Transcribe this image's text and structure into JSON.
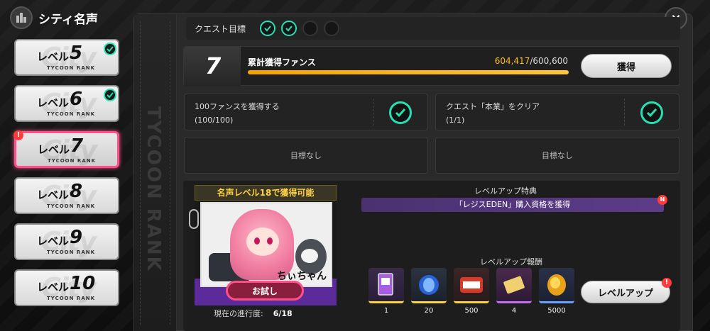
{
  "header": {
    "title": "シティ名声"
  },
  "ranks": [
    {
      "label": "レベル",
      "num": "5",
      "sub": "TYCOON RANK",
      "done": true
    },
    {
      "label": "レベル",
      "num": "6",
      "sub": "TYCOON RANK",
      "done": true
    },
    {
      "label": "レベル",
      "num": "7",
      "sub": "TYCOON RANK",
      "done": false,
      "alert": "!"
    },
    {
      "label": "レベル",
      "num": "8",
      "sub": "TYCOON RANK",
      "done": false
    },
    {
      "label": "レベル",
      "num": "9",
      "sub": "TYCOON RANK",
      "done": false
    },
    {
      "label": "レベル",
      "num": "10",
      "sub": "TYCOON RANK",
      "done": false
    }
  ],
  "side_watermark": "TYCOON RANK",
  "close_icon": "×",
  "quest": {
    "header_label": "クエスト目標",
    "goals_completed": 2,
    "goals_total": 4
  },
  "fans": {
    "level": "7",
    "label": "累計獲得ファンス",
    "current": "604,417",
    "total": "/600,600",
    "progress_pct": 100,
    "acquire_label": "獲得"
  },
  "conditions": [
    {
      "title": "100ファンスを獲得する",
      "progress": "(100/100)",
      "done": true
    },
    {
      "title": "クエスト「本業」をクリア",
      "progress": "(1/1)",
      "done": true
    }
  ],
  "empty_goals": [
    "目標なし",
    "目標なし"
  ],
  "character": {
    "banner": "名声レベル18で獲得可能",
    "name": "ちぃちゃん",
    "trial_label": "お試し",
    "progress_label": "現在の進行度:",
    "progress_value": "6/18"
  },
  "perks": {
    "title": "レベルアップ特典",
    "item": "「レジスEDEN」購入資格を獲得",
    "badge": "N"
  },
  "rewards": {
    "title": "レベルアップ報酬",
    "items": [
      {
        "count": "1",
        "icon": "card-icon",
        "color": "#ffd23f"
      },
      {
        "count": "20",
        "icon": "blue-gem-icon",
        "color": "#ffd23f"
      },
      {
        "count": "500",
        "icon": "token-icon",
        "color": "#ffd23f"
      },
      {
        "count": "4",
        "icon": "ticket-icon",
        "color": "#c46df0"
      },
      {
        "count": "5000",
        "icon": "gold-coin-icon",
        "color": "#6aa0ff"
      }
    ],
    "levelup_label": "レベルアップ",
    "levelup_alert": "!"
  },
  "colors": {
    "accent_teal": "#27e0b0",
    "accent_pink": "#ff4f8a",
    "accent_gold": "#ffbf1f"
  }
}
